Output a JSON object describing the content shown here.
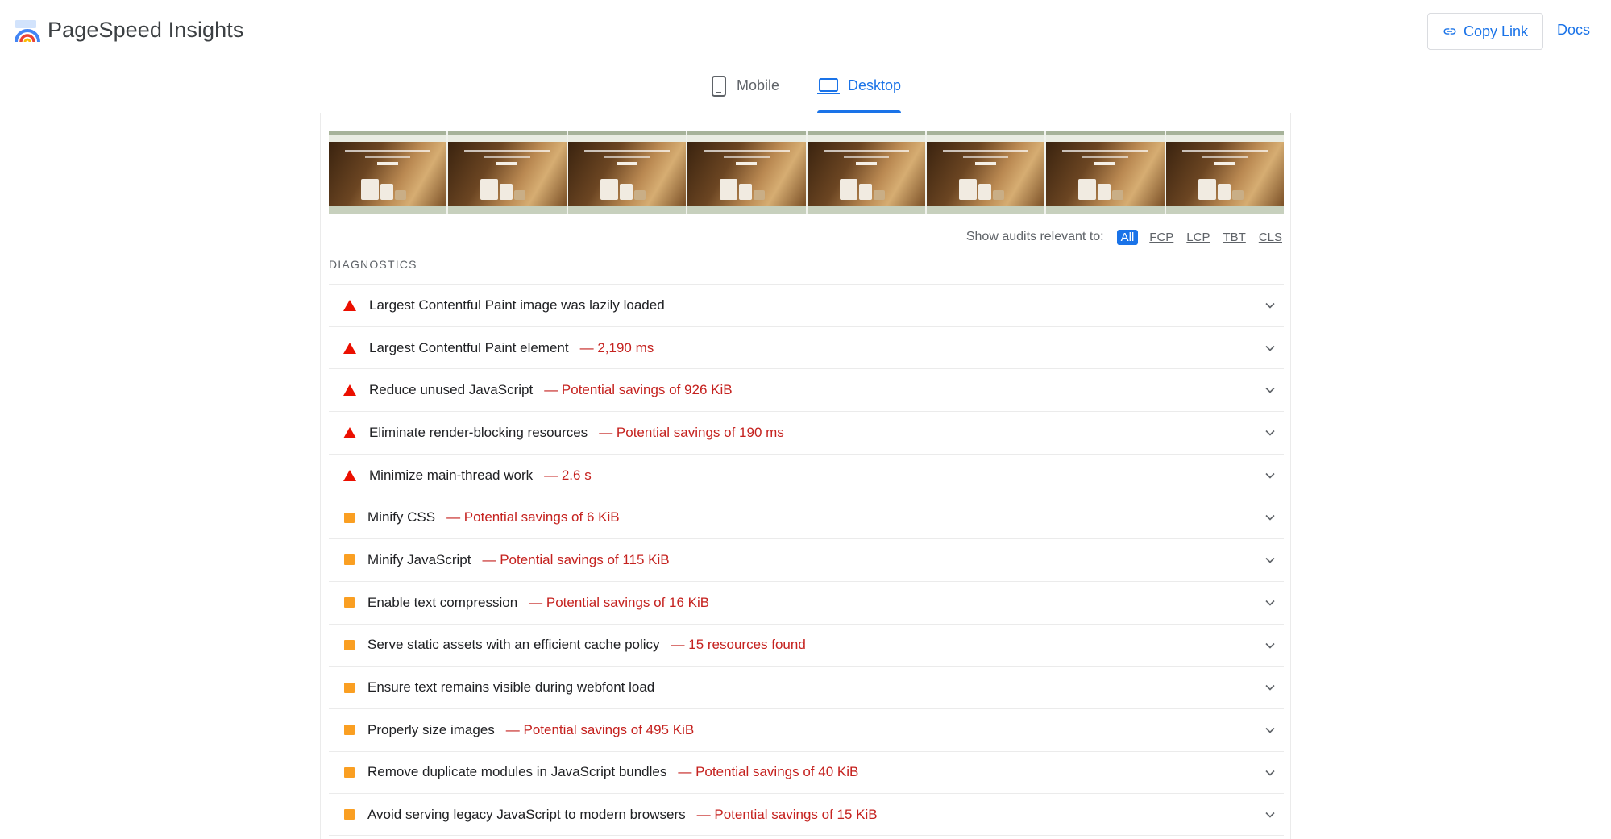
{
  "header": {
    "app_title": "PageSpeed Insights",
    "copy_link_label": "Copy Link",
    "docs_label": "Docs"
  },
  "tabs": [
    {
      "label": "Mobile",
      "icon": "phone-icon",
      "selected": false
    },
    {
      "label": "Desktop",
      "icon": "laptop-icon",
      "selected": true
    }
  ],
  "filter": {
    "label": "Show audits relevant to:",
    "options": [
      "All",
      "FCP",
      "LCP",
      "TBT",
      "CLS"
    ],
    "selected": "All"
  },
  "section_title": "DIAGNOSTICS",
  "audits": [
    {
      "status": "fail",
      "title": "Largest Contentful Paint image was lazily loaded",
      "value": ""
    },
    {
      "status": "fail",
      "title": "Largest Contentful Paint element",
      "value": "— 2,190 ms"
    },
    {
      "status": "fail",
      "title": "Reduce unused JavaScript",
      "value": "— Potential savings of 926 KiB"
    },
    {
      "status": "fail",
      "title": "Eliminate render-blocking resources",
      "value": "— Potential savings of 190 ms"
    },
    {
      "status": "fail",
      "title": "Minimize main-thread work",
      "value": "— 2.6 s"
    },
    {
      "status": "average",
      "title": "Minify CSS",
      "value": "— Potential savings of 6 KiB"
    },
    {
      "status": "average",
      "title": "Minify JavaScript",
      "value": "— Potential savings of 115 KiB"
    },
    {
      "status": "average",
      "title": "Enable text compression",
      "value": "— Potential savings of 16 KiB"
    },
    {
      "status": "average",
      "title": "Serve static assets with an efficient cache policy",
      "value": "— 15 resources found"
    },
    {
      "status": "average",
      "title": "Ensure text remains visible during webfont load",
      "value": ""
    },
    {
      "status": "average",
      "title": "Properly size images",
      "value": "— Potential savings of 495 KiB"
    },
    {
      "status": "average",
      "title": "Remove duplicate modules in JavaScript bundles",
      "value": "— Potential savings of 40 KiB"
    },
    {
      "status": "average",
      "title": "Avoid serving legacy JavaScript to modern browsers",
      "value": "— Potential savings of 15 KiB"
    }
  ],
  "colors": {
    "accent": "#1a73e8",
    "fail": "#eb0f00",
    "average": "#fa9f22",
    "value_text": "#c5221f"
  },
  "filmstrip_frames": 8
}
